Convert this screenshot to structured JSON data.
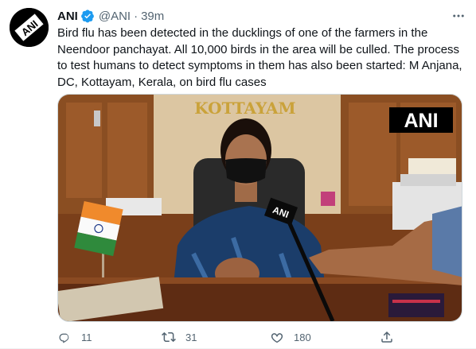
{
  "tweet": {
    "display_name": "ANI",
    "handle": "@ANI",
    "separator": "·",
    "time": "39m",
    "text": "Bird flu has been detected in the ducklings of one of the farmers in the Neendoor panchayat. All 10,000 birds in the area will be culled. The process to test humans to detect symptoms in them has also been started: M Anjana, DC, Kottayam, Kerala, on bird flu cases",
    "avatar_logo_text": "ANI",
    "media": {
      "sign_text": "KOTTAYAM",
      "watermark": "ANI",
      "mic_label": "ANI"
    }
  },
  "actions": {
    "reply_count": "11",
    "retweet_count": "31",
    "like_count": "180"
  },
  "colors": {
    "verified": "#1d9bf0",
    "secondary_text": "#536471",
    "primary_text": "#0f1419"
  },
  "icons": [
    "verified-badge-icon",
    "more-icon",
    "reply-icon",
    "retweet-icon",
    "like-icon",
    "share-icon"
  ]
}
